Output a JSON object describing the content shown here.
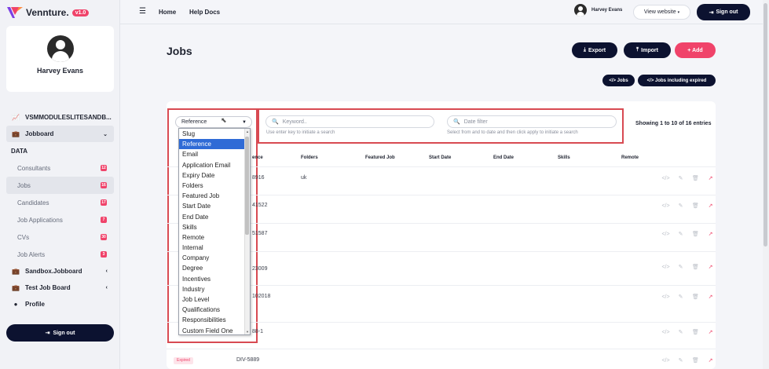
{
  "brand": {
    "name": "Vennture.",
    "version": "v1.0",
    "colors": {
      "accent": "#f0436a",
      "dark": "#0c1230",
      "select": "#2f6bd6",
      "highlight": "#d84a52"
    }
  },
  "sidebar": {
    "profile_name": "Harvey Evans",
    "site": "VSMMODULESLITESANDB...",
    "jobboard": "Jobboard",
    "section": "DATA",
    "items": [
      {
        "label": "Consultants",
        "count": "12"
      },
      {
        "label": "Jobs",
        "count": "16"
      },
      {
        "label": "Candidates",
        "count": "17"
      },
      {
        "label": "Job Applications",
        "count": "7"
      },
      {
        "label": "CVs",
        "count": "30"
      },
      {
        "label": "Job Alerts",
        "count": "3"
      }
    ],
    "boards": [
      "Sandbox.Jobboard",
      "Test Job Board"
    ],
    "profile_link": "Profile",
    "signout": "Sign out"
  },
  "topbar": {
    "home": "Home",
    "help": "Help Docs",
    "user": "Harvey Evans",
    "view_website": "View website",
    "signout": "Sign out"
  },
  "main": {
    "title": "Jobs",
    "export": "Export",
    "import": "Import",
    "add": "+ Add",
    "pill_jobs": "</> Jobs",
    "pill_expired": "</> Jobs including expired",
    "select_value": "Reference",
    "keyword_placeholder": "Keyword..",
    "keyword_help": "Use enter key to initiate a search",
    "date_placeholder": "Date filter",
    "date_help": "Select from and to date and then click apply to initiate a search",
    "showing": "Showing 1 to 10 of 16 entries",
    "columns": [
      "ence",
      "Folders",
      "Featured Job",
      "Start Date",
      "End Date",
      "Skills",
      "Remote"
    ],
    "rows": [
      {
        "ref": "8916",
        "folders": "uk"
      },
      {
        "ref": "41522",
        "folders": ""
      },
      {
        "ref": "51587",
        "folders": ""
      },
      {
        "ref": "23009",
        "folders": ""
      },
      {
        "ref": "102018",
        "folders": ""
      },
      {
        "ref": "88-1",
        "folders": ""
      },
      {
        "ref": "DIV-5889",
        "folders": "",
        "badge": "Expired"
      }
    ]
  },
  "dropdown_options": [
    "Slug",
    "Reference",
    "Email",
    "Application Email",
    "Expiry Date",
    "Folders",
    "Featured Job",
    "Start Date",
    "End Date",
    "Skills",
    "Remote",
    "Internal",
    "Company",
    "Degree",
    "Incentives",
    "Industry",
    "Job Level",
    "Qualifications",
    "Responsibilities",
    "Custom Field One"
  ],
  "dropdown_selected": "Reference"
}
